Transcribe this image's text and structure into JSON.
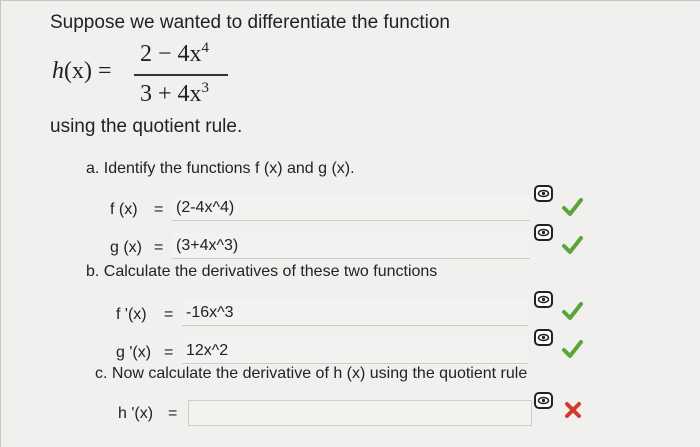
{
  "intro": "Suppose we wanted to differentiate the function",
  "function": {
    "lhs_name": "h",
    "lhs_var": "(x)",
    "equals": "=",
    "numerator": "2 − 4x",
    "numerator_exp": "4",
    "denominator": "3 + 4x",
    "denominator_exp": "3"
  },
  "using": "using the quotient rule.",
  "part_a": {
    "label": "a.  Identify the functions f (x) and g (x).",
    "f_label": "f (x)",
    "f_equals": "=",
    "f_value": "(2-4x^4)",
    "g_label": "g (x)",
    "g_equals": "=",
    "g_value": "(3+4x^3)"
  },
  "part_b": {
    "label": "b.  Calculate the derivatives of these two functions",
    "fp_label": "f '(x)",
    "fp_equals": "=",
    "fp_value": "-16x^3",
    "gp_label": "g '(x)",
    "gp_equals": "=",
    "gp_value": "12x^2"
  },
  "part_c": {
    "label": "c.  Now calculate the derivative of h (x) using the quotient rule",
    "hp_label": "h '(x)",
    "hp_equals": "=",
    "hp_value": ""
  },
  "icons": {
    "view": "eye-icon",
    "correct": "checkmark-icon",
    "incorrect": "cross-icon"
  },
  "colors": {
    "correct": "#5aa63b",
    "incorrect": "#d23a2f",
    "background": "#f1f0ee"
  }
}
